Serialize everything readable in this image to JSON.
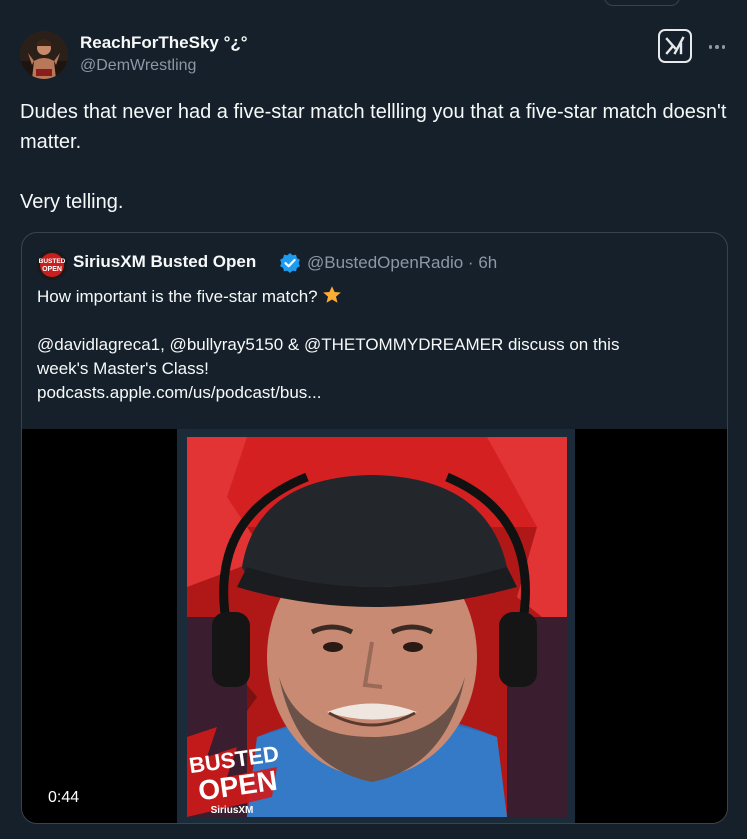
{
  "author": {
    "name": "ReachForTheSky °¿°",
    "handle": "@DemWrestling"
  },
  "tweet": {
    "text": "Dudes that never had a five-star match tellling you that a five-star match doesn't matter.\n\nVery telling."
  },
  "quoted": {
    "name": "SiriusXM Busted Open",
    "handle": "@BustedOpenRadio",
    "separator": "·",
    "time": "6h",
    "line1": "How important is the five-star match?",
    "line2": "@davidlagreca1, @bullyray5150 & @THETOMMYDREAMER discuss on this",
    "line3": "week's Master's Class!",
    "line4": "podcasts.apple.com/us/podcast/bus...",
    "avatar_text": "BUSTED OPEN"
  },
  "video": {
    "duration": "0:44",
    "logo_text_1": "BUSTED",
    "logo_text_2": "OPEN",
    "logo_text_3": "SiriusXM"
  },
  "icons": {
    "grok": "grok-icon",
    "more": "more-icon",
    "verified": "verified-badge-icon",
    "star": "star-emoji-icon"
  },
  "colors": {
    "background": "#15202b",
    "border": "#38444d",
    "secondary_text": "#8b98a5",
    "verified_blue": "#1d9bf0",
    "star_orange": "#ffac33"
  }
}
